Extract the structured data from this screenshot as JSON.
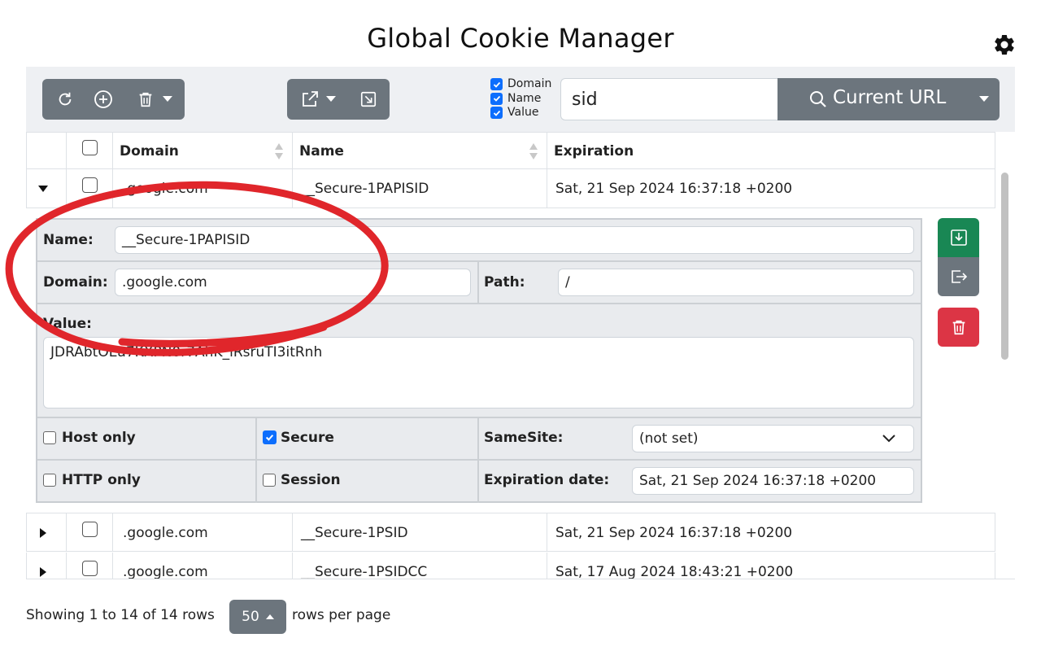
{
  "app": {
    "title": "Global Cookie Manager"
  },
  "search": {
    "filters": [
      {
        "label": "Domain",
        "checked": true
      },
      {
        "label": "Name",
        "checked": true
      },
      {
        "label": "Value",
        "checked": true
      }
    ],
    "query": "sid",
    "scope_button": "Current URL"
  },
  "table": {
    "columns": [
      "Domain",
      "Name",
      "Expiration"
    ],
    "rows": [
      {
        "domain": ".google.com",
        "name": "__Secure-1PAPISID",
        "expiration": "Sat, 21 Sep 2024 16:37:18 +0200",
        "expanded": true
      },
      {
        "domain": ".google.com",
        "name": "__Secure-1PSID",
        "expiration": "Sat, 21 Sep 2024 16:37:18 +0200",
        "expanded": false
      },
      {
        "domain": ".google.com",
        "name": "__Secure-1PSIDCC",
        "expiration": "Sat, 17 Aug 2024 18:43:21 +0200",
        "expanded": false
      }
    ]
  },
  "detail": {
    "name_label": "Name:",
    "name_value": "__Secure-1PAPISID",
    "domain_label": "Domain:",
    "domain_value": ".google.com",
    "path_label": "Path:",
    "path_value": "/",
    "value_label": "Value:",
    "value_value": "JDRAbtOEa7KXPN0r7AhK_iRsruTI3itRnh",
    "host_only_label": "Host only",
    "secure_label": "Secure",
    "samesite_label": "SameSite:",
    "samesite_value": "(not set)",
    "http_only_label": "HTTP only",
    "session_label": "Session",
    "expiration_label": "Expiration date:",
    "expiration_value": "Sat, 21 Sep 2024 16:37:18 +0200",
    "host_only": false,
    "secure": true,
    "http_only": false,
    "session": false
  },
  "footer": {
    "showing": "Showing 1 to 14 of 14 rows",
    "page_size": "50",
    "rows_per_page": "rows per page"
  },
  "colors": {
    "primary": "#0d6efd",
    "secondary": "#6c757d",
    "success": "#198754",
    "danger": "#dc3545",
    "annotation": "#e0262b"
  }
}
